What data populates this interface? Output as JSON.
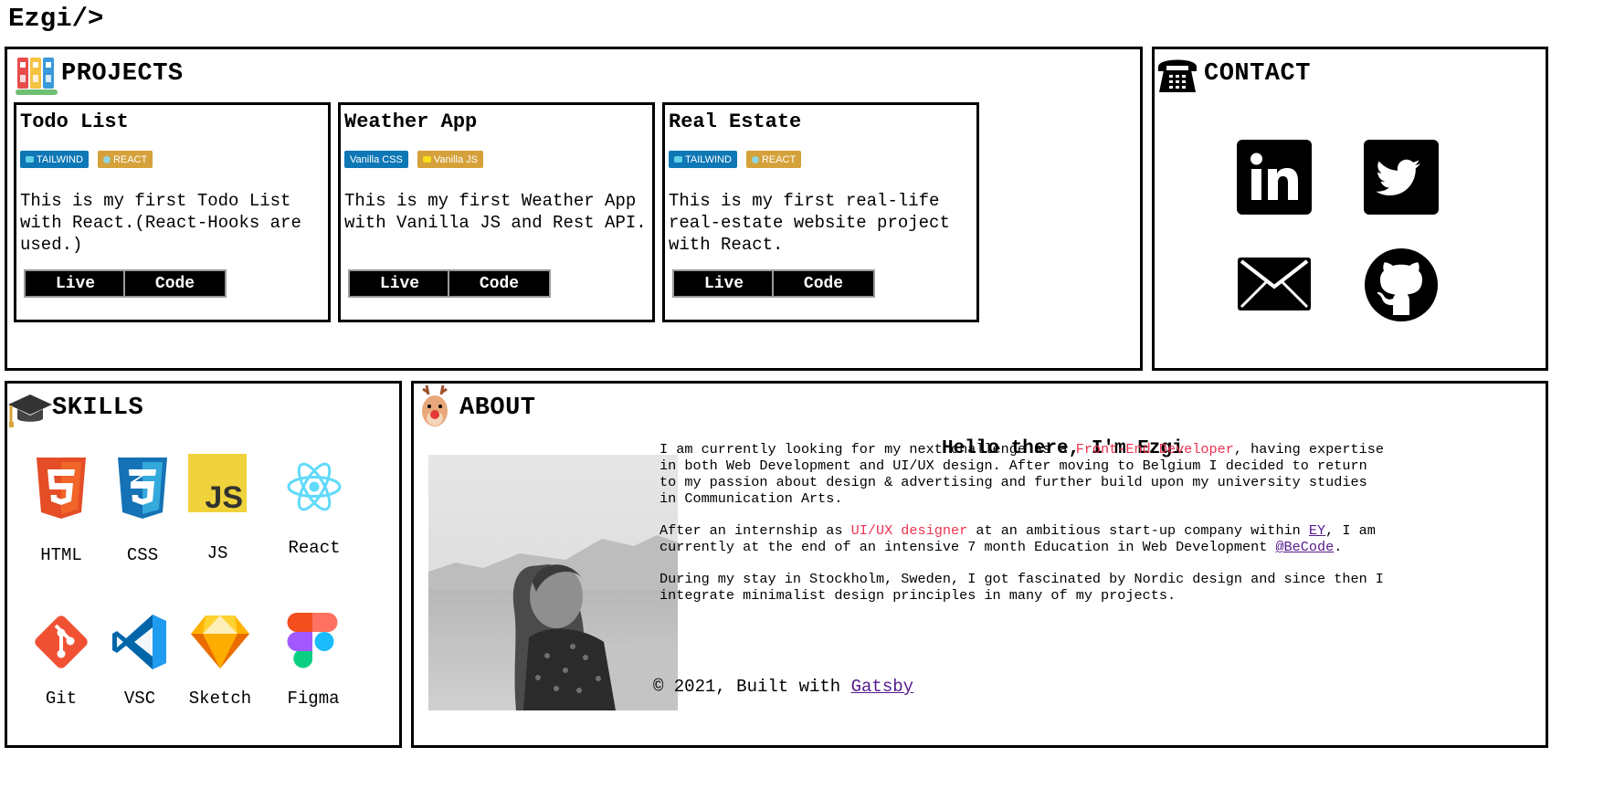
{
  "header": {
    "logo": "Ezgi/>"
  },
  "projects": {
    "title": "PROJECTS",
    "cards": [
      {
        "title": "Todo List",
        "badges": [
          {
            "label": "TAILWIND",
            "color": "#0e77b6",
            "icon": "tailwind-icon"
          },
          {
            "label": "REACT",
            "color": "#d5a13a",
            "icon": "react-icon"
          }
        ],
        "description": "This is my first Todo List with React.(React-Hooks are used.)",
        "live_label": "Live",
        "code_label": "Code"
      },
      {
        "title": "Weather App",
        "badges": [
          {
            "label": "Vanilla CSS",
            "color": "#0e77b6",
            "icon": ""
          },
          {
            "label": "Vanilla JS",
            "color": "#d5a13a",
            "icon": "js-icon"
          }
        ],
        "description": "This is my first Weather App with Vanilla JS and Rest API.",
        "live_label": "Live",
        "code_label": "Code"
      },
      {
        "title": "Real Estate",
        "badges": [
          {
            "label": "TAILWIND",
            "color": "#0e77b6",
            "icon": "tailwind-icon"
          },
          {
            "label": "REACT",
            "color": "#d5a13a",
            "icon": "react-icon"
          }
        ],
        "description": "This is my first real-life real-estate website project with React.",
        "live_label": "Live",
        "code_label": "Code"
      }
    ]
  },
  "contact": {
    "title": "CONTACT",
    "links": [
      "linkedin-icon",
      "twitter-icon",
      "mail-icon",
      "github-icon"
    ]
  },
  "skills": {
    "title": "SKILLS",
    "items": [
      {
        "label": "HTML",
        "icon": "html5-icon"
      },
      {
        "label": "CSS",
        "icon": "css3-icon"
      },
      {
        "label": "JS",
        "icon": "javascript-icon"
      },
      {
        "label": "React",
        "icon": "react-icon"
      },
      {
        "label": "Git",
        "icon": "git-icon"
      },
      {
        "label": "VSC",
        "icon": "vscode-icon"
      },
      {
        "label": "Sketch",
        "icon": "sketch-icon"
      },
      {
        "label": "Figma",
        "icon": "figma-icon"
      }
    ]
  },
  "about": {
    "title": "ABOUT",
    "heading": "Hello there, I'm Ezgi",
    "p1_a": "I am currently looking for my next challenge as a ",
    "p1_highlight": "Front-End Developer",
    "p1_b": ", having expertise in both Web Development and UI/UX design. After moving to Belgium I decided to return to my passion about design & advertising and further build upon my university studies in Communication Arts.",
    "p2_a": "After an internship as ",
    "p2_highlight": "UI/UX designer",
    "p2_b": " at an ambitious start-up company within ",
    "p2_link1": "EY",
    "p2_c": ", I am currently at the end of an intensive 7 month Education in Web Development ",
    "p2_link2": "@BeCode",
    "p2_d": ".",
    "p3": "During my stay in Stockholm, Sweden, I got fascinated by Nordic design and since then I integrate minimalist design principles in many of my projects."
  },
  "footer": {
    "text": "© 2021, Built with ",
    "link": "Gatsby"
  }
}
